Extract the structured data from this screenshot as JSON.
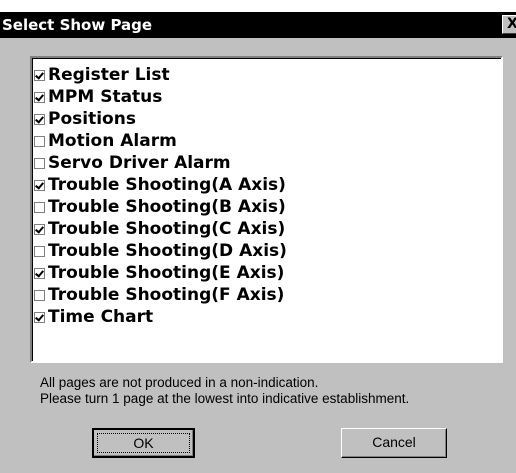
{
  "dialog": {
    "title": "Select Show Page",
    "close_label": "X"
  },
  "pages": [
    {
      "label": "Register List",
      "checked": true
    },
    {
      "label": "MPM Status",
      "checked": true
    },
    {
      "label": "Positions",
      "checked": true
    },
    {
      "label": "Motion Alarm",
      "checked": false
    },
    {
      "label": "Servo Driver Alarm",
      "checked": false
    },
    {
      "label": "Trouble Shooting(A Axis)",
      "checked": true
    },
    {
      "label": "Trouble Shooting(B Axis)",
      "checked": false
    },
    {
      "label": "Trouble Shooting(C Axis)",
      "checked": true
    },
    {
      "label": "Trouble Shooting(D Axis)",
      "checked": false
    },
    {
      "label": "Trouble Shooting(E Axis)",
      "checked": true
    },
    {
      "label": "Trouble Shooting(F Axis)",
      "checked": false
    },
    {
      "label": "Time Chart",
      "checked": true
    }
  ],
  "message": {
    "line1": "All pages are not produced in a non-indication.",
    "line2": "Please turn 1 page at the lowest into indicative establishment."
  },
  "buttons": {
    "ok_label": "OK",
    "cancel_label": "Cancel"
  }
}
